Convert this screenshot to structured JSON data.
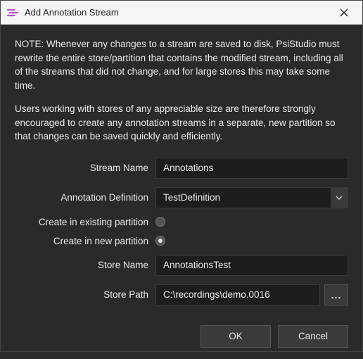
{
  "window": {
    "title": "Add Annotation Stream"
  },
  "notes": {
    "p1": "NOTE: Whenever any changes to a stream are saved to disk, PsiStudio must rewrite the entire store/partition that contains the modified stream, including all of the streams that did not change, and for large stores this may take some time.",
    "p2": "Users working with stores of any appreciable size are therefore strongly encouraged to create any annotation streams in a separate, new partition so that changes can be saved quickly and efficiently."
  },
  "form": {
    "stream_name": {
      "label": "Stream Name",
      "value": "Annotations"
    },
    "annotation_definition": {
      "label": "Annotation Definition",
      "value": "TestDefinition"
    },
    "create_existing": {
      "label": "Create in existing partition"
    },
    "create_new": {
      "label": "Create in new partition"
    },
    "store_name": {
      "label": "Store Name",
      "value": "AnnotationsTest"
    },
    "store_path": {
      "label": "Store Path",
      "value": "C:\\recordings\\demo.0016"
    },
    "browse": "..."
  },
  "buttons": {
    "ok": "OK",
    "cancel": "Cancel"
  },
  "colors": {
    "accent": "#b953c9",
    "bg": "#2a2a2a",
    "input_bg": "#1d1d1d",
    "btn_bg": "#3a3a3a"
  }
}
